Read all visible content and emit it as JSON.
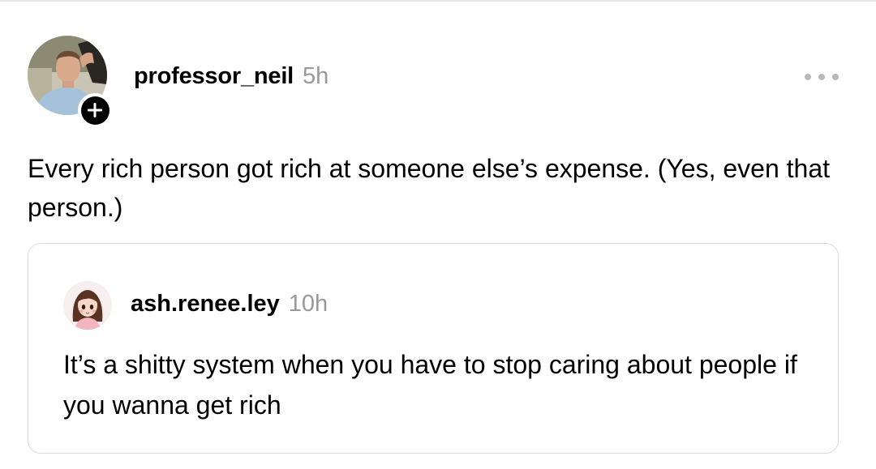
{
  "post": {
    "author": {
      "username": "professor_neil",
      "avatar_icon": "user-photo-avatar",
      "follow_icon": "plus-icon"
    },
    "timestamp": "5h",
    "more_icon": "more-horizontal-icon",
    "text": "Every rich person got rich at someone else’s expense. (Yes, even that person.)"
  },
  "quoted_post": {
    "author": {
      "username": "ash.renee.ley",
      "avatar_icon": "cartoon-avatar"
    },
    "timestamp": "10h",
    "text": "It’s a shitty system when you have to stop caring about people if you wanna get rich"
  },
  "colors": {
    "text": "#000000",
    "muted": "#999999",
    "border": "#dcdcdc",
    "badge": "#000000",
    "background": "#ffffff"
  }
}
